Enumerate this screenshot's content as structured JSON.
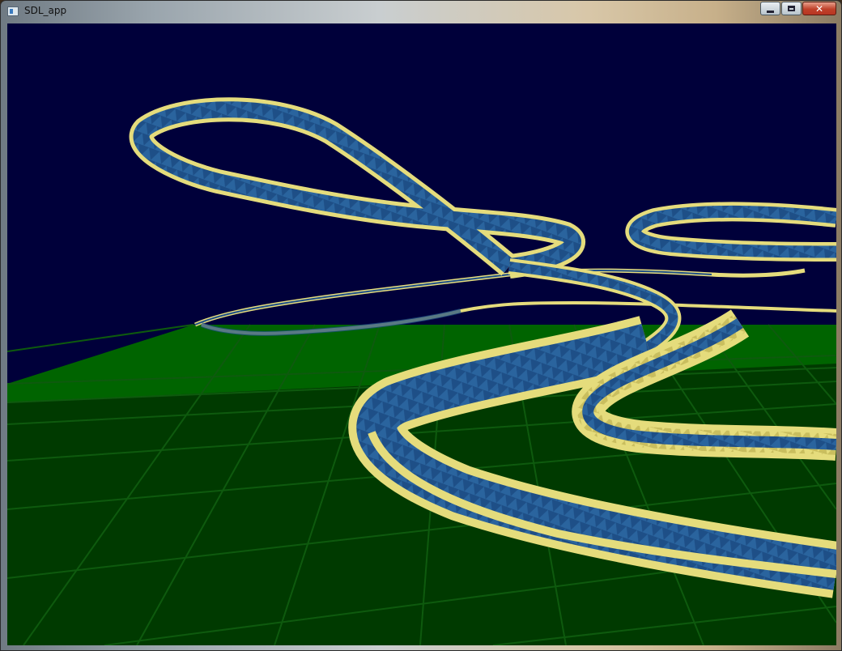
{
  "window": {
    "title": "SDL_app",
    "controls": {
      "minimize": "minimize",
      "maximize": "maximize",
      "close": "✕"
    }
  },
  "scene": {
    "background_color": "#00003a",
    "ground_color": "#006400",
    "grid_line_color": "#0e5a0e",
    "track_surface_color": "#1e4f87",
    "track_edge_color": "#e5dc7c"
  },
  "icons": [
    "app-icon",
    "minimize-icon",
    "maximize-icon",
    "close-icon"
  ]
}
